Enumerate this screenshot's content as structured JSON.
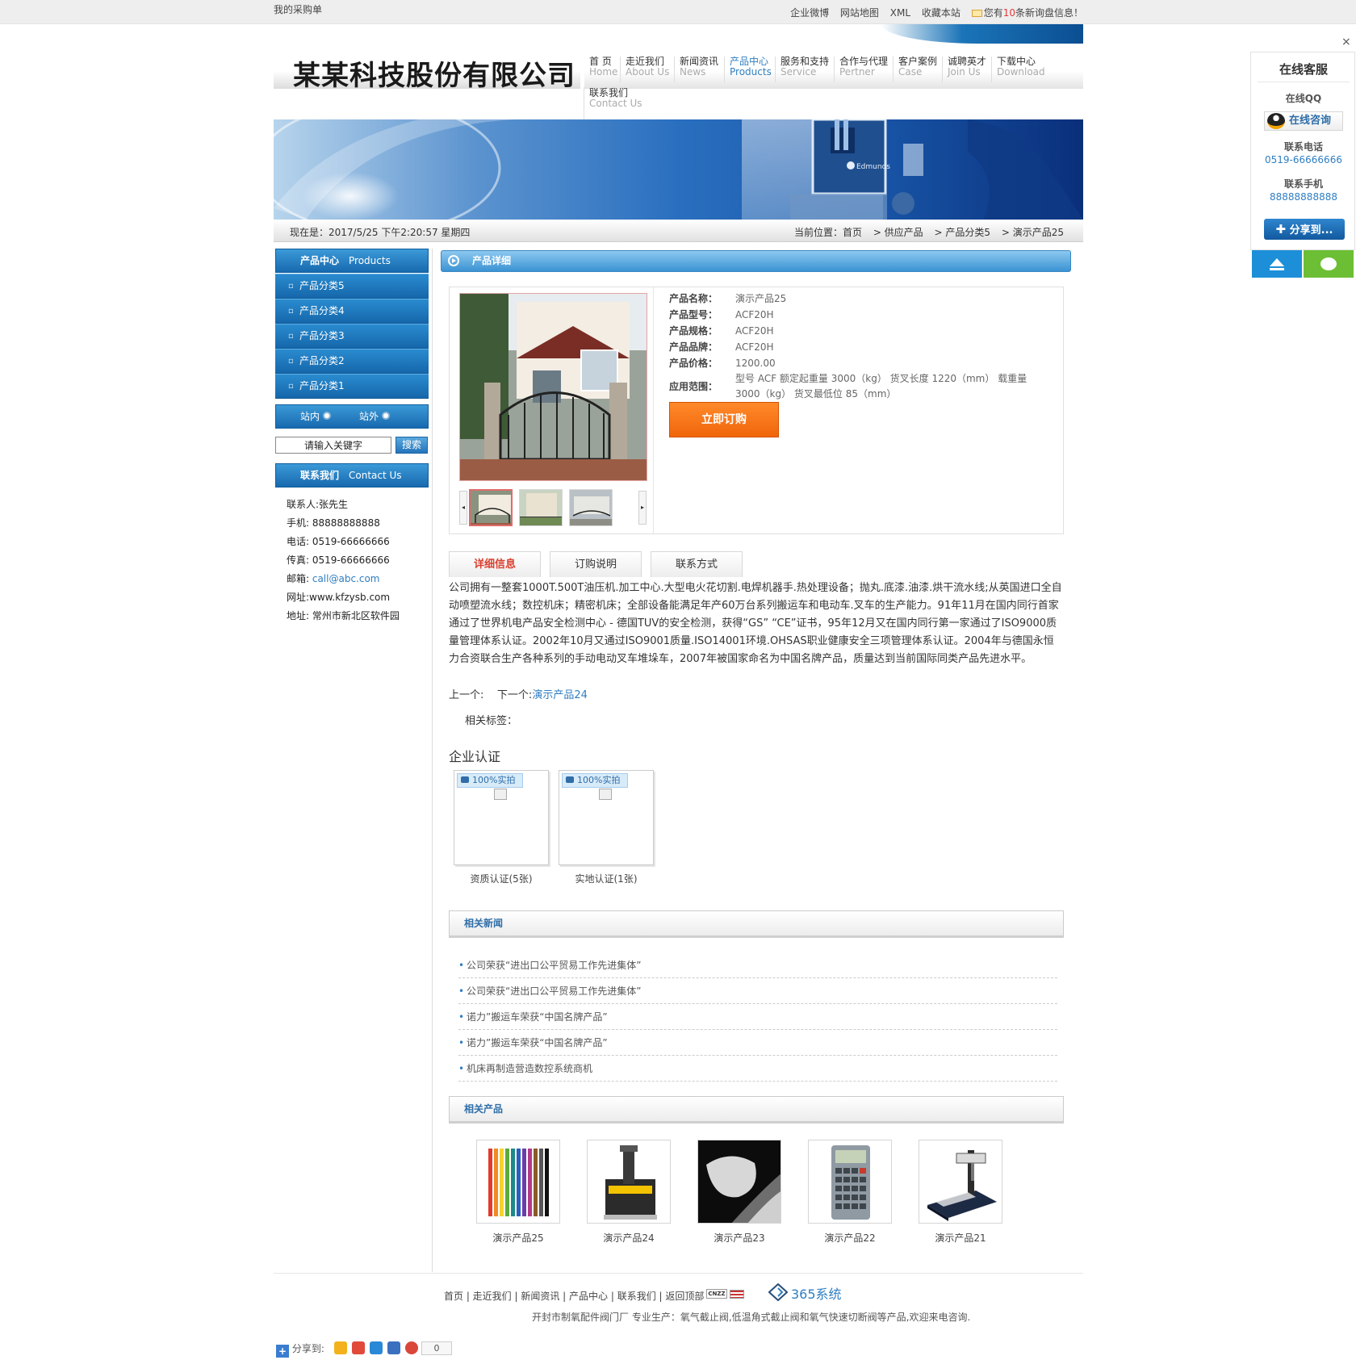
{
  "topbar": {
    "cart": "我的采购单",
    "links": [
      "企业微博",
      "网站地图",
      "XML",
      "收藏本站"
    ],
    "inquiry_pre": "您有",
    "inquiry_count": "10",
    "inquiry_post": "条新询盘信息！"
  },
  "header": {
    "company": "某某科技股份有限公司",
    "nav": [
      {
        "zh": "首 页",
        "en": "Home"
      },
      {
        "zh": "走近我们",
        "en": "About Us"
      },
      {
        "zh": "新闻资讯",
        "en": "News"
      },
      {
        "zh": "产品中心",
        "en": "Products"
      },
      {
        "zh": "服务和支持",
        "en": "Service"
      },
      {
        "zh": "合作与代理",
        "en": "Pertner"
      },
      {
        "zh": "客户案例",
        "en": "Case"
      },
      {
        "zh": "诚聘英才",
        "en": "Join Us"
      },
      {
        "zh": "下载中心",
        "en": "Download"
      },
      {
        "zh": "联系我们",
        "en": "Contact Us"
      }
    ]
  },
  "banner": {
    "brand_text": "Edmunds"
  },
  "datebar": {
    "now": "现在是：2017/5/25 下午2:20:57 星期四",
    "location_label": "当前位置：",
    "crumbs": [
      "首页",
      "> 供应产品",
      "> 产品分类5",
      "> 演示产品25"
    ]
  },
  "sidebar": {
    "products_zh": "产品中心",
    "products_en": "Products",
    "categories": [
      "产品分类5",
      "产品分类4",
      "产品分类3",
      "产品分类2",
      "产品分类1"
    ],
    "scope_inside": "站内",
    "scope_outside": "站外",
    "search_placeholder": "请输入关键字",
    "search_button": "搜索",
    "contact_zh": "联系我们",
    "contact_en": "Contact Us",
    "contact_lines": [
      "联系人:张先生",
      "手机: 88888888888",
      "电话: 0519-66666666",
      "传真: 0519-66666666"
    ],
    "email_label": "邮箱: ",
    "email": "call@abc.com",
    "contact_lines2": [
      "网址:www.kfzysb.com",
      "地址: 常州市新北区软件园"
    ]
  },
  "detail": {
    "section_title": "产品详细",
    "attrs": [
      {
        "k": "产品名称：",
        "v": "演示产品25"
      },
      {
        "k": "产品型号：",
        "v": "ACF20H"
      },
      {
        "k": "产品规格：",
        "v": "ACF20H"
      },
      {
        "k": "产品品牌：",
        "v": "ACF20H"
      },
      {
        "k": "产品价格：",
        "v": "1200.00"
      }
    ],
    "scope_k": "应用范围：",
    "scope_v": "型号 ACF 额定起重量 3000（kg） 货叉长度 1220（mm） 载重量 3000（kg） 货叉最低位 85（mm）",
    "order_button": "立即订购",
    "tabs": [
      "详细信息",
      "订购说明",
      "联系方式"
    ],
    "description": "公司拥有一整套1000T.500T油压机.加工中心.大型电火花切割.电焊机器手.热处理设备；抛丸.底漆.油漆.烘干流水线;从英国进口全自动喷塑流水线；数控机床；精密机床；全部设备能满足年产60万台系列搬运车和电动车.叉车的生产能力。91年11月在国内同行首家通过了世界机电产品安全检测中心 - 德国TUV的安全检测，获得“GS” “CE”证书，95年12月又在国内同行第一家通过了ISO9000质量管理体系认证。2002年10月又通过ISO9001质量.ISO14001环境.OHSAS职业健康安全三项管理体系认证。2004年与德国永恒力合资联合生产各种系列的手动电动叉车堆垛车，2007年被国家命名为中国名牌产品，质量达到当前国际同类产品先进水平。",
    "prev_label": "上一个:",
    "next_label": "下一个:",
    "next_link": "演示产品24",
    "tags_label": "相关标签："
  },
  "certs": {
    "title": "企业认证",
    "badge": "100%实拍",
    "items": [
      "资质认证(5张)",
      "实地认证(1张)"
    ]
  },
  "news": {
    "title": "相关新闻",
    "items": [
      "公司荣获“进出口公平贸易工作先进集体”",
      "公司荣获“进出口公平贸易工作先进集体”",
      "诺力”搬运车荣获“中国名牌产品”",
      "诺力”搬运车荣获“中国名牌产品”",
      "机床再制造营造数控系统商机"
    ]
  },
  "related": {
    "title": "相关产品",
    "items": [
      "演示产品25",
      "演示产品24",
      "演示产品23",
      "演示产品22",
      "演示产品21"
    ]
  },
  "footer": {
    "links": "首页 | 走近我们 | 新闻资讯 | 产品中心 | 联系我们 | 返回顶部",
    "cnzz": "CNZZ",
    "brand": "365系统",
    "copy": "开封市制氧配件阀门厂   专业生产：氧气截止阀,低温角式截止阀和氧气快速切断阀等产品,欢迎来电咨询.",
    "share_label": "分享到:",
    "share_count": "0"
  },
  "cs": {
    "title": "在线客服",
    "qq_label": "在线QQ",
    "qq_button": "在线咨询",
    "phone_label": "联系电话",
    "phone": "0519-66666666",
    "mobile_label": "联系手机",
    "mobile": "88888888888",
    "share_button": "分享到...",
    "close": "×"
  }
}
